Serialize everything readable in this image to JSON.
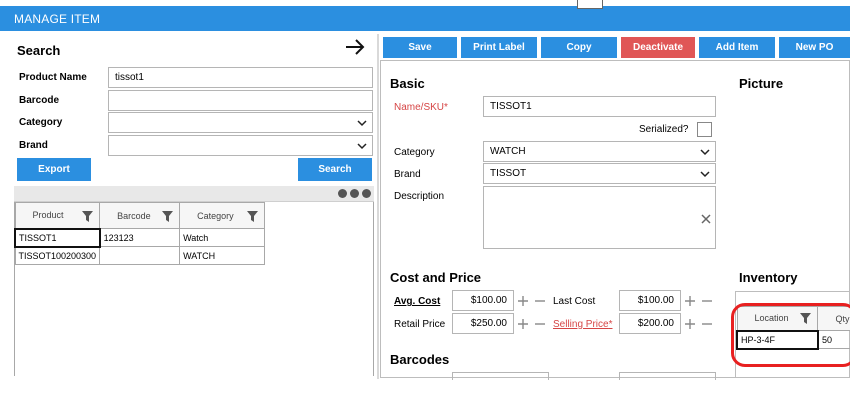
{
  "window": {
    "title": "MANAGE ITEM"
  },
  "search": {
    "title": "Search",
    "product_name_label": "Product Name",
    "product_name_value": "tissot1",
    "barcode_label": "Barcode",
    "barcode_value": "",
    "category_label": "Category",
    "category_value": "",
    "brand_label": "Brand",
    "brand_value": "",
    "export_label": "Export",
    "search_label": "Search"
  },
  "results": {
    "columns": [
      "Product",
      "Barcode",
      "Category"
    ],
    "rows": [
      {
        "product": "TISSOT1",
        "barcode": "123123",
        "category": "Watch"
      },
      {
        "product": "TISSOT100200300",
        "barcode": "",
        "category": "WATCH"
      }
    ]
  },
  "toolbar": {
    "save": "Save",
    "print_label": "Print Label",
    "copy": "Copy",
    "deactivate": "Deactivate",
    "add_item": "Add Item",
    "new_po": "New PO"
  },
  "basic": {
    "title": "Basic",
    "name_label": "Name/SKU",
    "required_mark": "*",
    "name_value": "TISSOT1",
    "serialized_label": "Serialized?",
    "serialized": false,
    "category_label": "Category",
    "category_value": "WATCH",
    "brand_label": "Brand",
    "brand_value": "TISSOT",
    "description_label": "Description",
    "description_value": ""
  },
  "picture": {
    "title": "Picture"
  },
  "cost_price": {
    "title": "Cost and Price",
    "avg_cost_label": "Avg. Cost",
    "avg_cost_value": "$100.00",
    "last_cost_label": "Last Cost",
    "last_cost_value": "$100.00",
    "retail_price_label": "Retail Price",
    "retail_price_value": "$250.00",
    "selling_price_label": "Selling Price",
    "selling_price_value": "$200.00"
  },
  "barcodes": {
    "title": "Barcodes"
  },
  "inventory": {
    "title": "Inventory",
    "columns": [
      "Location",
      "Qty"
    ],
    "rows": [
      {
        "location": "HP-3-4F",
        "qty": "50"
      }
    ]
  },
  "colors": {
    "accent": "#2b8fe0",
    "danger": "#e05656",
    "highlight": "#e82020"
  },
  "icons": {
    "back_arrow": "arrow-right-icon",
    "dropdown": "chevron-down-icon",
    "filter": "filter-icon",
    "clear": "close-icon",
    "increment": "plus-icon",
    "decrement": "minus-icon",
    "more": "more-dots-icon"
  }
}
